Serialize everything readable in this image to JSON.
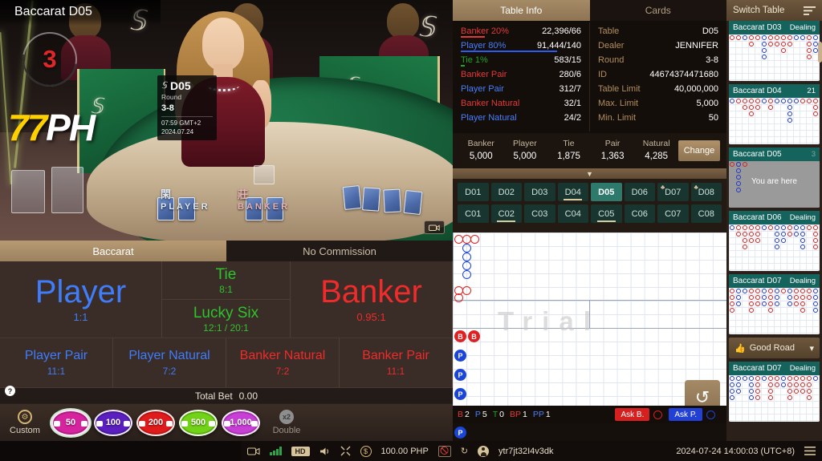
{
  "video": {
    "title": "Baccarat D05",
    "countdown": "3",
    "brand_yellow": "77",
    "brand_white": "PH",
    "info_card": {
      "logo": "SA",
      "table": "D05",
      "round_label": "Round",
      "round": "3-8",
      "time": "07:59 GMT+2",
      "date": "2024.07.24"
    },
    "felt_player_cjk": "閑",
    "felt_player": "PLAYER",
    "felt_banker_cjk": "莊",
    "felt_banker": "BANKER",
    "camera_icon": "camera-icon"
  },
  "bet_panel": {
    "tabs": [
      {
        "label": "Baccarat",
        "active": true
      },
      {
        "label": "No Commission",
        "active": false
      }
    ],
    "player": {
      "label": "Player",
      "odds": "1:1"
    },
    "tie": {
      "label": "Tie",
      "odds": "8:1"
    },
    "lucky_six": {
      "label": "Lucky Six",
      "odds": "12:1 / 20:1"
    },
    "banker": {
      "label": "Banker",
      "odds": "0.95:1"
    },
    "help_icon": "?",
    "side_bets": [
      {
        "label": "Player Pair",
        "odds": "11:1",
        "color": "player"
      },
      {
        "label": "Player Natural",
        "odds": "7:2",
        "color": "player"
      },
      {
        "label": "Banker Natural",
        "odds": "7:2",
        "color": "banker"
      },
      {
        "label": "Banker Pair",
        "odds": "11:1",
        "color": "banker"
      }
    ],
    "total_bet_label": "Total Bet",
    "total_bet_value": "0.00"
  },
  "chips": {
    "custom_label": "Custom",
    "double_label": "Double",
    "double_badge": "x2",
    "items": [
      {
        "value": "50",
        "color": "#d6249f",
        "selected": true
      },
      {
        "value": "100",
        "color": "#5a1fbe",
        "selected": false
      },
      {
        "value": "200",
        "color": "#e01b1b",
        "selected": false
      },
      {
        "value": "500",
        "color": "#72d217",
        "selected": false
      },
      {
        "value": "1,000",
        "color": "#c83fd6",
        "selected": false
      }
    ]
  },
  "table_info": {
    "tab_info": "Table Info",
    "tab_cards": "Cards",
    "stats": [
      {
        "label": "Banker 20%",
        "value": "22,396/66",
        "color": "banker",
        "bar_pct": 20
      },
      {
        "label": "Player 80%",
        "value": "91,444/140",
        "color": "player",
        "bar_pct": 80
      },
      {
        "label": "Tie 1%",
        "value": "583/15",
        "color": "tie",
        "bar_pct": 3
      },
      {
        "label": "Banker Pair",
        "value": "280/6",
        "color": "banker",
        "bar_pct": 0
      },
      {
        "label": "Player Pair",
        "value": "312/7",
        "color": "player",
        "bar_pct": 0
      },
      {
        "label": "Banker Natural",
        "value": "32/1",
        "color": "banker",
        "bar_pct": 0
      },
      {
        "label": "Player Natural",
        "value": "24/2",
        "color": "player",
        "bar_pct": 0
      }
    ],
    "details": [
      {
        "label": "Table",
        "value": "D05"
      },
      {
        "label": "Dealer",
        "value": "JENNIFER"
      },
      {
        "label": "Round",
        "value": "3-8"
      },
      {
        "label": "ID",
        "value": "44674374471680"
      },
      {
        "label": "Table Limit",
        "value": "40,000,000"
      },
      {
        "label": "Max. Limit",
        "value": "5,000"
      },
      {
        "label": "Min. Limit",
        "value": "50"
      }
    ],
    "limits": [
      {
        "label": "Banker",
        "value": "5,000"
      },
      {
        "label": "Player",
        "value": "5,000"
      },
      {
        "label": "Tie",
        "value": "1,875"
      },
      {
        "label": "Pair",
        "value": "1,363"
      },
      {
        "label": "Natural",
        "value": "4,285"
      }
    ],
    "change_label": "Change",
    "collapse_icon": "chevron-down-icon"
  },
  "table_grid": {
    "rows": [
      [
        {
          "label": "D01"
        },
        {
          "label": "D02"
        },
        {
          "label": "D03"
        },
        {
          "label": "D04",
          "underline": true
        },
        {
          "label": "D05",
          "selected": true
        },
        {
          "label": "D06"
        },
        {
          "label": "D07",
          "dot": true
        },
        {
          "label": "D08",
          "dot": true
        }
      ],
      [
        {
          "label": "C01"
        },
        {
          "label": "C02",
          "underline": true
        },
        {
          "label": "C03"
        },
        {
          "label": "C04"
        },
        {
          "label": "C05",
          "underline": true
        },
        {
          "label": "C06"
        },
        {
          "label": "C07"
        },
        {
          "label": "C08"
        }
      ]
    ]
  },
  "roadmap": {
    "watermark": "Trial",
    "undo_icon": "undo-icon",
    "stats": [
      {
        "label": "B",
        "value": "2",
        "color": "banker"
      },
      {
        "label": "P",
        "value": "5",
        "color": "player"
      },
      {
        "label": "T",
        "value": "0",
        "color": "tie"
      },
      {
        "label": "BP",
        "value": "1",
        "color": "banker"
      },
      {
        "label": "PP",
        "value": "1",
        "color": "player"
      }
    ],
    "ask_banker": "Ask B.",
    "ask_player": "Ask P.",
    "bead_road": [
      {
        "t": "b",
        "label": "B"
      },
      {
        "t": "b",
        "label": "B"
      },
      {
        "t": "p",
        "label": "P"
      },
      {
        "t": "p",
        "label": "P"
      },
      {
        "t": "p",
        "label": "P"
      },
      {
        "t": "p",
        "label": "P"
      },
      {
        "t": "p",
        "label": "P"
      }
    ]
  },
  "sidebar": {
    "title": "Switch Table",
    "menu_icon": "filter-icon",
    "good_road_label": "Good Road",
    "good_road_icon": "thumbs-up-icon",
    "good_road_chevron": "chevron-down-icon",
    "tables": [
      {
        "name": "Baccarat D03",
        "status": "Dealing",
        "here": false
      },
      {
        "name": "Baccarat D04",
        "status": "21",
        "here": false
      },
      {
        "name": "Baccarat D05",
        "status": "3",
        "here": true,
        "hint": "You are here"
      },
      {
        "name": "Baccarat D06",
        "status": "Dealing",
        "here": false
      },
      {
        "name": "Baccarat D07",
        "status": "Dealing",
        "here": false
      },
      {
        "name": "Baccarat D07",
        "status": "Dealing",
        "here": false
      }
    ]
  },
  "bottom_bar": {
    "live_icon": "live-video-icon",
    "signal_icon": "signal-bars-icon",
    "quality": "HD",
    "volume_icon": "volume-icon",
    "fullscreen_icon": "fullscreen-icon",
    "coin_icon": "coin-icon",
    "balance": "100.00 PHP",
    "no_photo_icon": "no-photo-icon",
    "refresh_icon": "refresh-icon",
    "avatar_icon": "avatar-icon",
    "username": "ytr7jt32I4v3dk",
    "datetime": "2024-07-24  14:00:03 (UTC+8)",
    "menu_icon": "hamburger-menu-icon"
  }
}
